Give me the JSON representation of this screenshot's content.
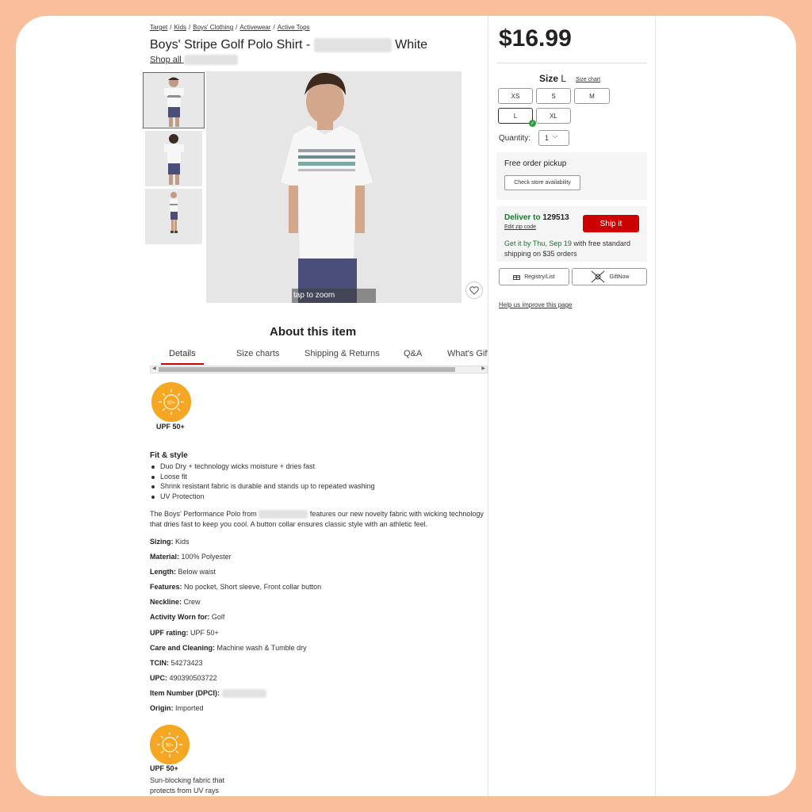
{
  "breadcrumbs": [
    "Target",
    "Kids",
    "Boys' Clothing",
    "Activewear",
    "Active Tops"
  ],
  "product": {
    "title_prefix": "Boys' Stripe Golf Polo Shirt -",
    "title_suffix": "White",
    "shop_all": "Shop all"
  },
  "gallery": {
    "zoom_hint": "tap to zoom"
  },
  "about": {
    "heading": "About this item",
    "tabs": [
      "Details",
      "Size charts",
      "Shipping & Returns",
      "Q&A",
      "What's GiftNow"
    ]
  },
  "details": {
    "upf_badge_text": "50+",
    "upf_label": "UPF 50+",
    "fit_heading": "Fit & style",
    "bullets": [
      "Duo Dry + technology wicks moisture + dries fast",
      "Loose fit",
      "Shrink resistant fabric is durable and stands up to repeated washing",
      "UV Protection"
    ],
    "para_a": "The Boys' Performance Polo from",
    "para_b": "features our new novelty fabric with wicking technology that dries fast to keep you cool. A button collar ensures classic style with an athletic feel.",
    "specs": [
      {
        "label": "Sizing:",
        "value": "Kids"
      },
      {
        "label": "Material:",
        "value": "100% Polyester"
      },
      {
        "label": "Length:",
        "value": "Below waist"
      },
      {
        "label": "Features:",
        "value": "No pocket, Short sleeve, Front collar button"
      },
      {
        "label": "Neckline:",
        "value": "Crew"
      },
      {
        "label": "Activity Worn for:",
        "value": "Golf"
      },
      {
        "label": "UPF rating:",
        "value": "UPF 50+"
      },
      {
        "label": "Care and Cleaning:",
        "value": "Machine wash & Tumble dry"
      },
      {
        "label": "TCIN:",
        "value": "54273423"
      },
      {
        "label": "UPC:",
        "value": "490390503722"
      },
      {
        "label": "Item Number (DPCI):",
        "value": ""
      },
      {
        "label": "Origin:",
        "value": "Imported"
      }
    ],
    "upf_bottom_label": "UPF 50+",
    "upf_desc_1": "Sun-blocking fabric that",
    "upf_desc_2": "protects from UV rays"
  },
  "buybox": {
    "price": "$16.99",
    "size_label": "Size",
    "size_value": "L",
    "size_chart": "Size chart",
    "sizes": [
      "XS",
      "S",
      "M",
      "L",
      "XL"
    ],
    "selected_size": "L",
    "quantity_label": "Quantity:",
    "quantity_value": "1",
    "pickup_title": "Free order pickup",
    "check_store": "Check store availability",
    "deliver_to": "Deliver to",
    "zip": "129513",
    "edit_zip": "Edit zip code",
    "ship_it": "Ship it",
    "get_it_by": "Get it by Thu, Sep 19",
    "shipping_note": "with free standard shipping on $35 orders",
    "registry": "Registry/List",
    "giftnow": "GiftNow",
    "help": "Help us improve this page"
  },
  "colors": {
    "accent_red": "#cc0000",
    "deliver_green": "#137a2e",
    "badge_orange": "#f5a623",
    "border_peach": "#f9bf9b"
  }
}
